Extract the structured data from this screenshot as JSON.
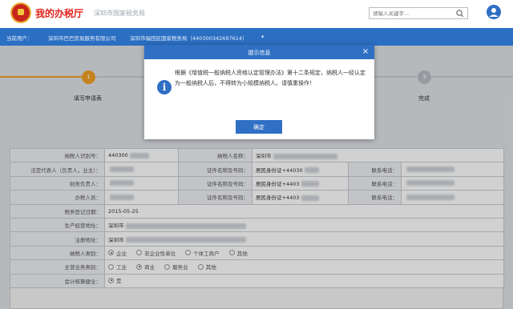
{
  "header": {
    "title": "我的办税厅",
    "subtitle": "深圳市国家税务局",
    "search_placeholder": "请输入关键字..."
  },
  "navbar": {
    "current_user_label": "当前用户：",
    "current_user_value": "深圳市巴巴贸易服务有限公司",
    "tax_office": "深圳市福田区国家税务局（440300342697614）",
    "dropdown_caret": "▾"
  },
  "steps": [
    {
      "number": "1",
      "label": "填写申请表",
      "state": "active"
    },
    {
      "number": "3",
      "label": "完成",
      "state": "inactive"
    }
  ],
  "form": {
    "rows": [
      {
        "label1": "纳税人识别号：",
        "value1": "440300",
        "label2": "纳税人名称：",
        "value2": "深圳市"
      },
      {
        "label1": "法定代表人（负责人，业主）：",
        "value1": "",
        "label2": "证件名称及号码：",
        "value2": "居民身份证+44030",
        "label3": "联系电话：",
        "value3": ""
      },
      {
        "label1": "财务负责人：",
        "value1": "",
        "label2": "证件名称及号码：",
        "value2": "居民身份证+4403",
        "label3": "联系电话：",
        "value3": ""
      },
      {
        "label1": "办税人员：",
        "value1": "",
        "label2": "证件名称及号码：",
        "value2": "居民身份证+4403",
        "label3": "联系电话：",
        "value3": ""
      },
      {
        "label1": "税务登记日期：",
        "value1": "2015-05-25"
      },
      {
        "label1": "生产经营地址：",
        "value1": "深圳市"
      },
      {
        "label1": "注册地址：",
        "value1": "深圳市"
      }
    ],
    "taxpayer_type": {
      "label": "纳税人类别：",
      "options": [
        "企业",
        "非企业性单位",
        "个体工商户",
        "其他"
      ],
      "selected": "企业"
    },
    "main_business": {
      "label": "主营业务类别：",
      "options": [
        "工业",
        "商业",
        "服务业",
        "其他"
      ],
      "selected": "商业"
    },
    "accounting": {
      "label": "会计核算健全：",
      "options": [
        "是"
      ],
      "selected": "是"
    }
  },
  "modal": {
    "title": "提示信息",
    "close_symbol": "×",
    "icon_symbol": "i",
    "message": "根据《增值税一般纳税人资格认定管理办法》第十二条规定，纳税人一经认定为一般纳税人后，不得转为小规模纳税人。请慎重操作！",
    "ok_label": "确定"
  },
  "colors": {
    "brand_blue": "#2b6fc2",
    "title_red": "#e1231c",
    "step_orange": "#f1a124"
  },
  "icons": {
    "search": "search-icon",
    "user": "user-icon",
    "info": "info-icon",
    "close": "close-icon",
    "emblem": "emblem-icon"
  }
}
